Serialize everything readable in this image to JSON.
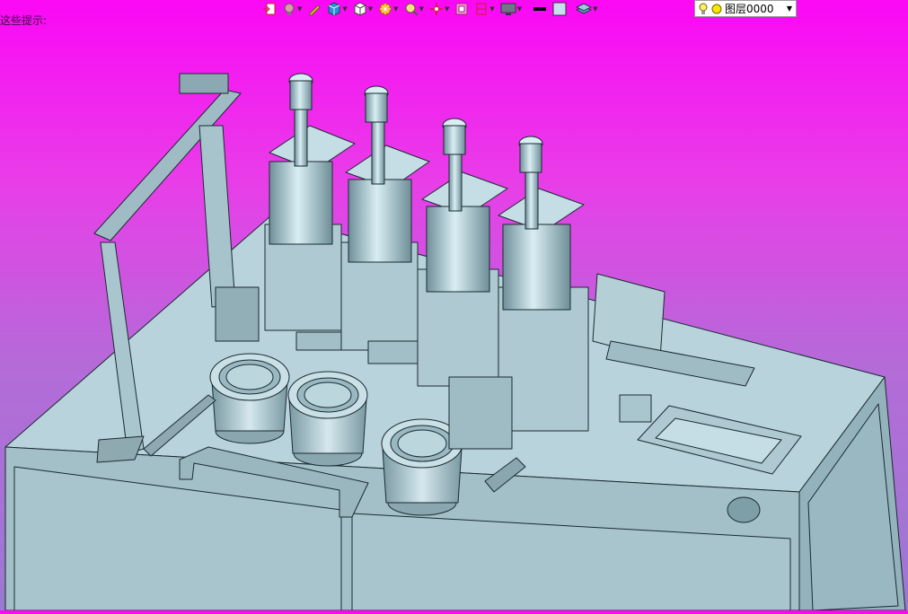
{
  "hint": {
    "text": "这些提示:"
  },
  "toolbar": {
    "buttons": [
      {
        "name": "new-view-icon",
        "dropdown": false
      },
      {
        "name": "render-style-icon",
        "dropdown": true
      },
      {
        "name": "pen-icon",
        "dropdown": false
      },
      {
        "name": "shaded-cube-icon",
        "dropdown": true
      },
      {
        "name": "wire-cube-icon",
        "dropdown": true
      },
      {
        "name": "color-wheel-icon",
        "dropdown": true
      },
      {
        "name": "zoom-icon",
        "dropdown": true
      },
      {
        "name": "pan-icon",
        "dropdown": true
      },
      {
        "name": "frame-icon",
        "dropdown": false
      },
      {
        "name": "section-icon",
        "dropdown": true
      },
      {
        "name": "monitor-icon",
        "dropdown": true
      },
      {
        "name": "line-color-icon",
        "dropdown": false
      },
      {
        "name": "fill-color-icon",
        "dropdown": false
      },
      {
        "name": "layer-stack-icon",
        "dropdown": true
      }
    ]
  },
  "layer": {
    "label": "图层0000"
  },
  "colors": {
    "background_top": "#fb08f5",
    "background_bottom": "#9a7ad0",
    "model_body": "#a9c6cf",
    "model_edge": "#1a2a30"
  }
}
